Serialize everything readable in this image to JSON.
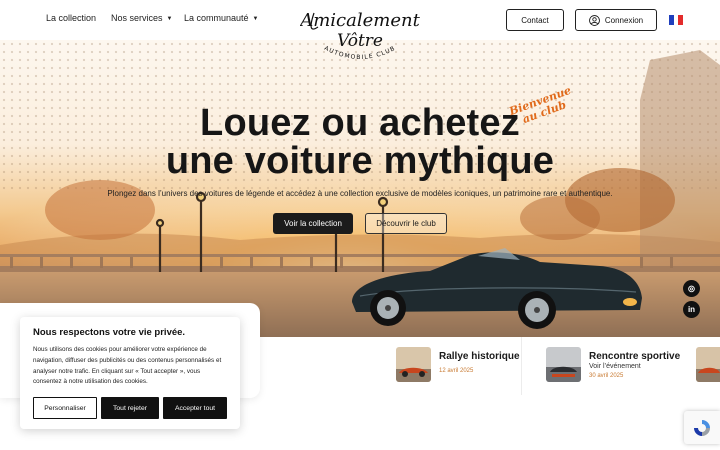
{
  "nav": {
    "links": [
      {
        "label": "La collection"
      },
      {
        "label": "Nos services",
        "caret": "▼"
      },
      {
        "label": "La communauté",
        "caret": "▼"
      }
    ],
    "logo": {
      "line1": "Amicalement",
      "line2": "Vôtre",
      "line3": "AUTOMOBILE CLUB"
    },
    "contact_label": "Contact",
    "login_label": "Connexion",
    "language_flag": {
      "name": "france-flag",
      "colors": [
        "#1f3fbd",
        "#ffffff",
        "#e32b2b"
      ]
    }
  },
  "hero": {
    "title_line1": "Louez ou achetez",
    "title_line2": "une voiture mythique",
    "script_line1": "Bienvenue",
    "script_line2": "au club",
    "subtitle": "Plongez dans l’univers des voitures de légende et accédez à une collection exclusive de modèles iconiques, un patrimoine rare et authentique.",
    "primary_cta": "Voir la collection",
    "secondary_cta": "Découvrir le club",
    "accent_color": "#e06a1b"
  },
  "social": [
    {
      "icon": "instagram-icon",
      "glyph": "◎"
    },
    {
      "icon": "linkedin-icon",
      "glyph": "in"
    }
  ],
  "events": [
    {
      "title": "Rallye historique",
      "date": "12 avril 2025"
    },
    {
      "title": "Rencontre sportive",
      "subtitle": "Voir l’événement",
      "date": "30 avril 2025"
    }
  ],
  "cookie": {
    "title": "Nous respectons votre vie privée.",
    "text": "Nous utilisons des cookies pour améliorer votre expérience de navigation, diffuser des publicités ou des contenus personnalisés et analyser notre trafic. En cliquant sur « Tout accepter », vous consentez à notre utilisation des cookies.",
    "customize_label": "Personnaliser",
    "reject_label": "Tout rejeter",
    "accept_label": "Accepter tout"
  }
}
